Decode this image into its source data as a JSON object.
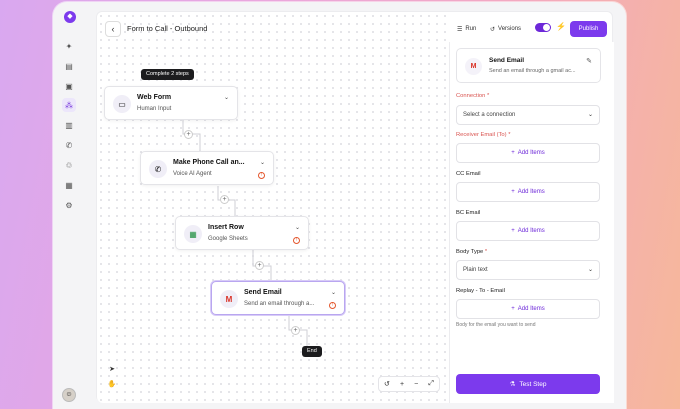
{
  "app": {
    "logo_icon": "chat-bubble-icon",
    "accent": "#7c3aed",
    "rail": [
      {
        "icon": "sparkle-icon"
      },
      {
        "icon": "document-icon"
      },
      {
        "icon": "inbox-icon"
      },
      {
        "icon": "workflow-icon",
        "active": true
      },
      {
        "icon": "book-icon"
      },
      {
        "icon": "phone-icon"
      },
      {
        "icon": "recycle-icon"
      },
      {
        "icon": "building-icon"
      },
      {
        "icon": "gear-icon"
      }
    ]
  },
  "header": {
    "back": "‹",
    "title": "Form to Call - Outbound",
    "run_label": "Run",
    "versions_label": "Versions",
    "publish_label": "Publish"
  },
  "canvas": {
    "progress_tag": "Complete 2 steps",
    "end_label": "End",
    "nodes": [
      {
        "title": "Web Form",
        "subtitle": "Human Input",
        "icon": "form-icon",
        "warning": false
      },
      {
        "title": "Make Phone Call an...",
        "subtitle": "Voice AI Agent",
        "icon": "phone-icon",
        "warning": true
      },
      {
        "title": "Insert Row",
        "subtitle": "Google Sheets",
        "icon": "sheets-icon",
        "warning": true
      },
      {
        "title": "Send Email",
        "subtitle": "Send an email through a...",
        "icon": "gmail-icon",
        "warning": true,
        "selected": true
      }
    ],
    "zoom_controls": [
      "history-icon",
      "+",
      "−",
      "fit-icon"
    ]
  },
  "panel": {
    "card_title": "Send Email",
    "card_subtitle": "Send an email through a gmail ac...",
    "fields": {
      "connection_label": "Connection",
      "connection_placeholder": "Select a connection",
      "receiver_label": "Receiver Email (To)",
      "cc_label": "CC Email",
      "bc_label": "BC Email",
      "body_type_label": "Body Type",
      "body_type_value": "Plain text",
      "replay_label": "Replay - To - Email",
      "add_items": "Add Items",
      "body_hint": "Body for the email you want to send",
      "required_mark": "*"
    },
    "test_step_label": "Test Step"
  }
}
